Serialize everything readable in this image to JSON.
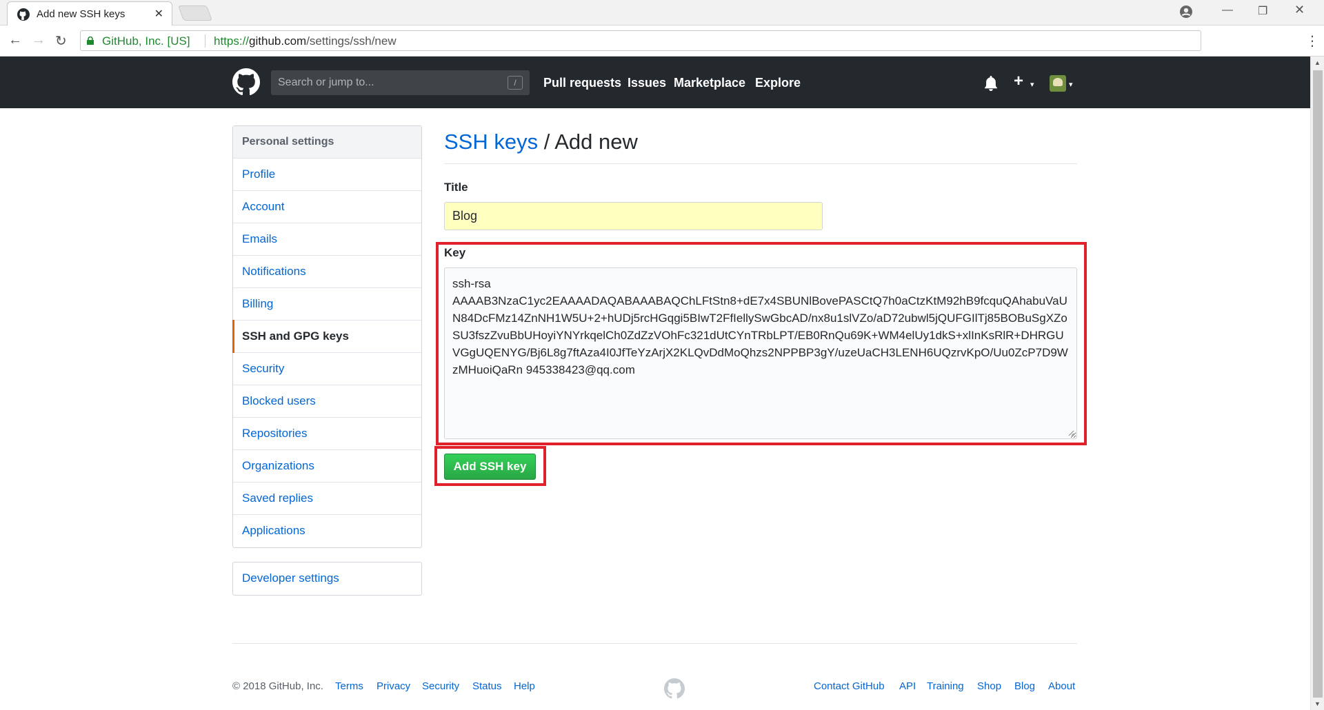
{
  "browser": {
    "tab_title": "Add new SSH keys",
    "tab_close": "✕",
    "secure_label": "GitHub, Inc. [US]",
    "url_scheme": "https://",
    "url_host": "github.com",
    "url_path": "/settings/ssh/new"
  },
  "header": {
    "search_placeholder": "Search or jump to...",
    "search_shortcut": "/",
    "nav": {
      "pulls": "Pull requests",
      "issues": "Issues",
      "marketplace": "Marketplace",
      "explore": "Explore"
    },
    "plus": "+",
    "caret": "▾"
  },
  "sidebar": {
    "heading": "Personal settings",
    "items": [
      {
        "label": "Profile"
      },
      {
        "label": "Account"
      },
      {
        "label": "Emails"
      },
      {
        "label": "Notifications"
      },
      {
        "label": "Billing"
      },
      {
        "label": "SSH and GPG keys"
      },
      {
        "label": "Security"
      },
      {
        "label": "Blocked users"
      },
      {
        "label": "Repositories"
      },
      {
        "label": "Organizations"
      },
      {
        "label": "Saved replies"
      },
      {
        "label": "Applications"
      }
    ],
    "selected": "SSH and GPG keys",
    "developer": "Developer settings"
  },
  "main": {
    "breadcrumb_link": "SSH keys",
    "breadcrumb_rest": " / Add new",
    "title_label": "Title",
    "title_value": "Blog",
    "key_label": "Key",
    "key_value": "ssh-rsa\nAAAAB3NzaC1yc2EAAAADAQABAAABAQChLFtStn8+dE7x4SBUNlBovePASCtQ7h0aCtzKtM92hB9fcquQAhabuVaUN84DcFMz14ZnNH1W5U+2+hUDj5rcHGqgi5BIwT2FfIellySwGbcAD/nx8u1slVZo/aD72ubwl5jQUFGIlTj85BOBuSgXZoSU3fszZvuBbUHoyiYNYrkqelCh0ZdZzVOhFc321dUtCYnTRbLPT/EB0RnQu69K+WM4elUy1dkS+xlInKsRlR+DHRGUVGgUQENYG/Bj6L8g7ftAza4I0JfTeYzArjX2KLQvDdMoQhzs2NPPBP3gY/uzeUaCH3LENH6UQzrvKpO/Uu0ZcP7D9WzMHuoiQaRn 945338423@qq.com",
    "submit_label": "Add SSH key"
  },
  "footer": {
    "copyright": "© 2018 GitHub, Inc.",
    "left_links": [
      "Terms",
      "Privacy",
      "Security",
      "Status",
      "Help"
    ],
    "right_links": [
      "Contact GitHub",
      "API",
      "Training",
      "Shop",
      "Blog",
      "About"
    ]
  },
  "colors": {
    "header_bg": "#24292e",
    "link": "#0366d6",
    "accent_selected": "#e36209",
    "button_green": "#28a745",
    "annotation_red": "#e0202a",
    "autofill_yellow": "#ffffc0"
  }
}
